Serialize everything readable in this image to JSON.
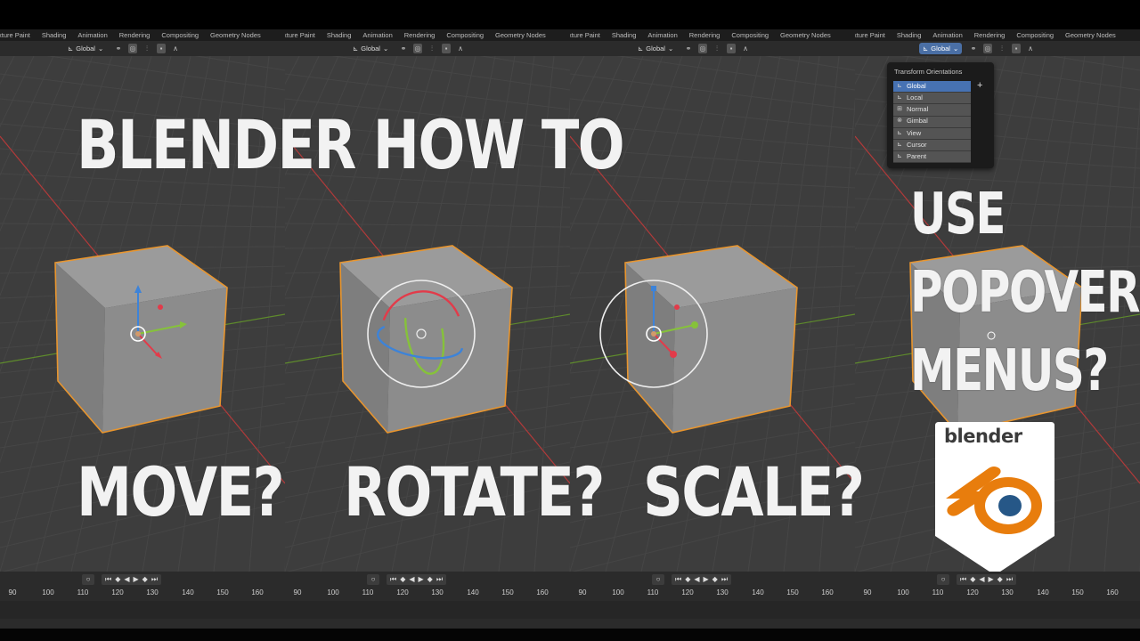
{
  "header_tabs": [
    "xture Paint",
    "Shading",
    "Animation",
    "Rendering",
    "Compositing",
    "Geometry Nodes"
  ],
  "toolbar": {
    "orientation_value": "Global",
    "icons": [
      "orientation-axes-icon",
      "pivot-point-icon",
      "snap-magnet-icon",
      "snap-target-icon",
      "proportional-edit-icon",
      "falloff-curve-icon"
    ]
  },
  "headlines": {
    "main_title": "BLENDER HOW TO",
    "move": "MOVE?",
    "rotate": "ROTATE?",
    "scale": "SCALE?",
    "popover_line1": "USE",
    "popover_line2": "POPOVER",
    "popover_line3": "MENUS?"
  },
  "popover": {
    "title": "Transform Orientations",
    "items": [
      {
        "label": "Global",
        "icon": "global-axes-icon",
        "selected": true
      },
      {
        "label": "Local",
        "icon": "local-axes-icon",
        "selected": false
      },
      {
        "label": "Normal",
        "icon": "normal-icon",
        "selected": false
      },
      {
        "label": "Gimbal",
        "icon": "gimbal-icon",
        "selected": false
      },
      {
        "label": "View",
        "icon": "view-icon",
        "selected": false
      },
      {
        "label": "Cursor",
        "icon": "cursor-icon",
        "selected": false
      },
      {
        "label": "Parent",
        "icon": "parent-icon",
        "selected": false
      }
    ],
    "add_symbol": "+"
  },
  "logo": {
    "wordmark": "blender",
    "colors": {
      "orange": "#e87d0d",
      "blue": "#265787",
      "white": "#ffffff"
    }
  },
  "timeline": {
    "frame_numbers": [
      "90",
      "100",
      "110",
      "120",
      "130",
      "140",
      "150",
      "160"
    ]
  },
  "colors": {
    "viewport_bg": "#3d3d3d",
    "grid_line": "#464646",
    "x_axis": "#b13a3a",
    "y_axis": "#5e8a2c",
    "cube_face_front": "#8c8c8c",
    "cube_outline": "#e8952e",
    "gizmo_red": "#e23b4a",
    "gizmo_green": "#86c23a",
    "gizmo_blue": "#3d83d8",
    "selected_blue": "#4772b3"
  }
}
